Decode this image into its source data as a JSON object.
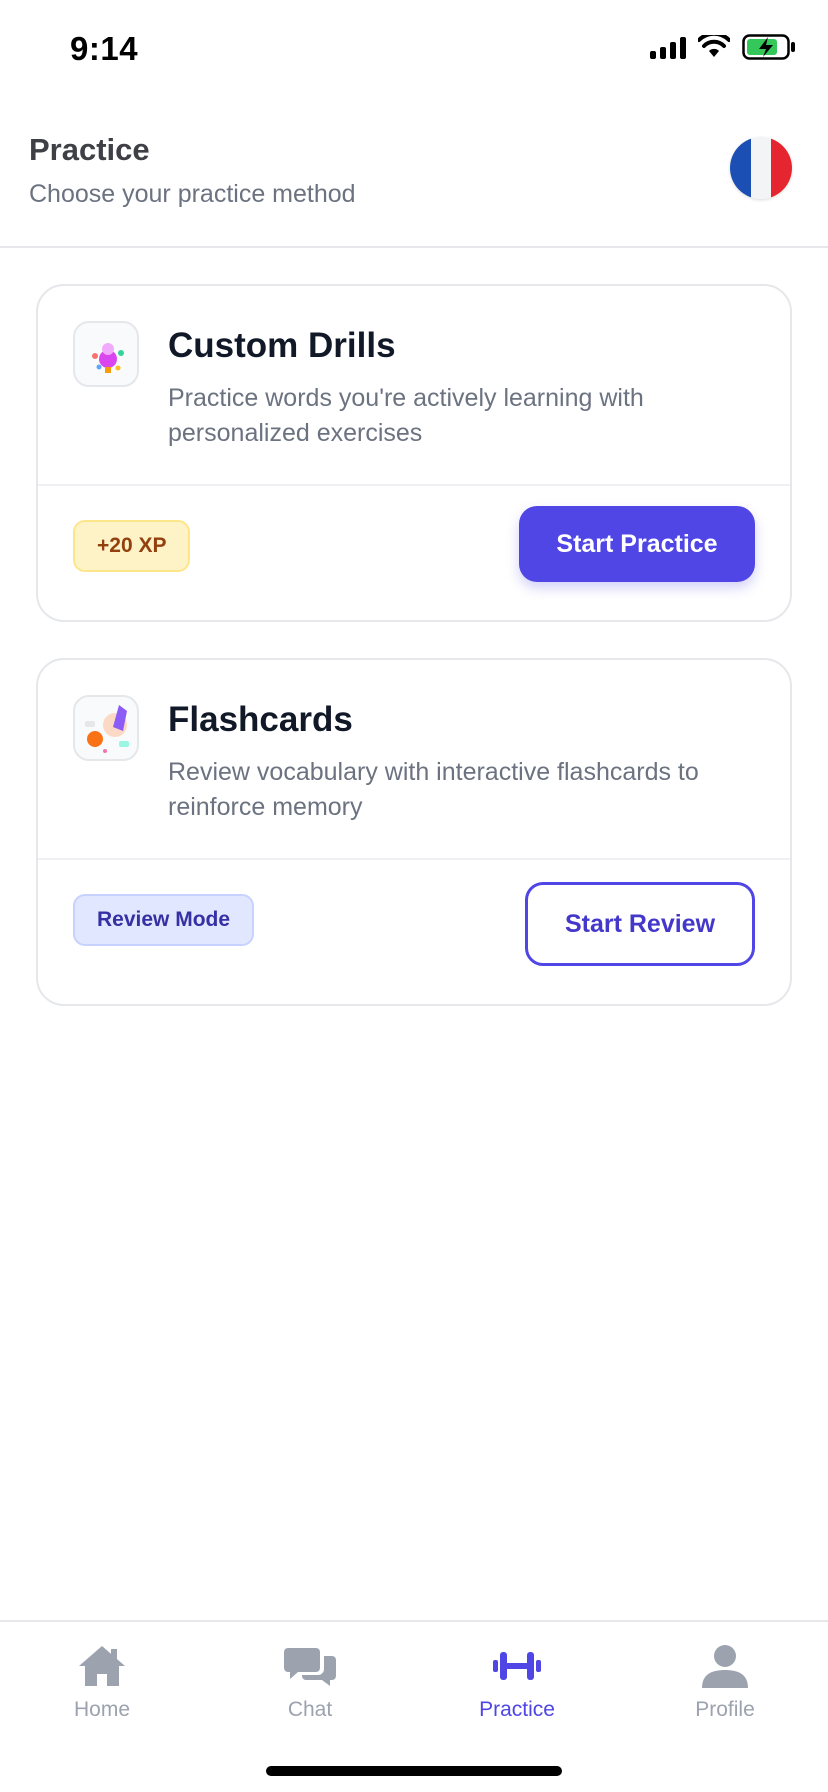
{
  "status_bar": {
    "time": "9:14"
  },
  "header": {
    "title": "Practice",
    "subtitle": "Choose your practice method",
    "language_flag": "france-flag-icon"
  },
  "cards": [
    {
      "title": "Custom Drills",
      "description": "Practice words you're actively learning with personalized exercises",
      "badge": "+20 XP",
      "button": "Start Practice",
      "icon": "custom-drills-illustration-icon"
    },
    {
      "title": "Flashcards",
      "description": "Review vocabulary with interactive flashcards to reinforce memory",
      "badge": "Review Mode",
      "button": "Start Review",
      "icon": "flashcards-illustration-icon"
    }
  ],
  "tab_bar": {
    "items": [
      {
        "label": "Home",
        "icon": "home-icon"
      },
      {
        "label": "Chat",
        "icon": "chat-icon"
      },
      {
        "label": "Practice",
        "icon": "dumbbell-icon",
        "active": true
      },
      {
        "label": "Profile",
        "icon": "profile-icon"
      }
    ]
  },
  "colors": {
    "accent": "#4f46e5",
    "xp_badge_bg": "#fef3c7",
    "review_badge_bg": "#e0e7ff",
    "inactive_tab": "#9ca3af"
  }
}
